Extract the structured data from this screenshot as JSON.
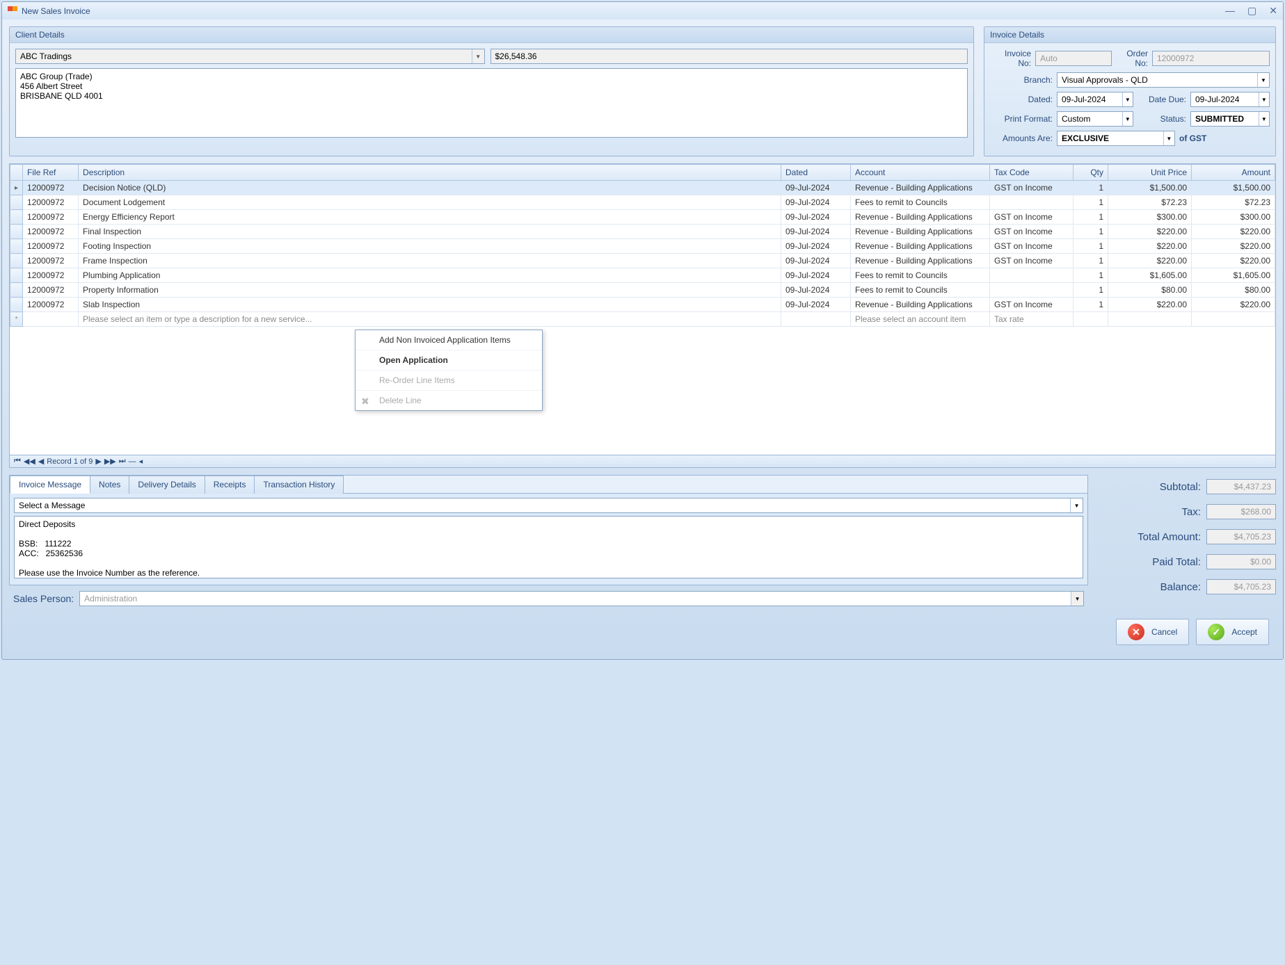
{
  "window": {
    "title": "New Sales Invoice"
  },
  "client": {
    "panel_title": "Client Details",
    "name": "ABC Tradings",
    "amount": "$26,548.36",
    "address": "ABC Group (Trade)\n456 Albert Street\nBRISBANE QLD 4001"
  },
  "invoice": {
    "panel_title": "Invoice Details",
    "labels": {
      "invoice_no": "Invoice No:",
      "order_no": "Order No:",
      "branch": "Branch:",
      "dated": "Dated:",
      "date_due": "Date Due:",
      "print_format": "Print Format:",
      "status": "Status:",
      "amounts_are": "Amounts Are:",
      "of_gst": "of GST"
    },
    "invoice_no": "Auto",
    "order_no": "12000972",
    "branch": "Visual Approvals - QLD",
    "dated": "09-Jul-2024",
    "date_due": "09-Jul-2024",
    "print_format": "Custom",
    "status": "SUBMITTED",
    "amounts_are": "EXCLUSIVE"
  },
  "grid": {
    "headers": {
      "file_ref": "File Ref",
      "description": "Description",
      "dated": "Dated",
      "account": "Account",
      "tax_code": "Tax Code",
      "qty": "Qty",
      "unit_price": "Unit Price",
      "amount": "Amount"
    },
    "rows": [
      {
        "file_ref": "12000972",
        "description": "Decision Notice (QLD)",
        "dated": "09-Jul-2024",
        "account": "Revenue - Building Applications",
        "tax_code": "GST on Income",
        "qty": "1",
        "unit_price": "$1,500.00",
        "amount": "$1,500.00"
      },
      {
        "file_ref": "12000972",
        "description": "Document Lodgement",
        "dated": "09-Jul-2024",
        "account": "Fees to remit to Councils",
        "tax_code": "",
        "qty": "1",
        "unit_price": "$72.23",
        "amount": "$72.23"
      },
      {
        "file_ref": "12000972",
        "description": "Energy Efficiency Report",
        "dated": "09-Jul-2024",
        "account": "Revenue - Building Applications",
        "tax_code": "GST on Income",
        "qty": "1",
        "unit_price": "$300.00",
        "amount": "$300.00"
      },
      {
        "file_ref": "12000972",
        "description": "Final Inspection",
        "dated": "09-Jul-2024",
        "account": "Revenue - Building Applications",
        "tax_code": "GST on Income",
        "qty": "1",
        "unit_price": "$220.00",
        "amount": "$220.00"
      },
      {
        "file_ref": "12000972",
        "description": "Footing Inspection",
        "dated": "09-Jul-2024",
        "account": "Revenue - Building Applications",
        "tax_code": "GST on Income",
        "qty": "1",
        "unit_price": "$220.00",
        "amount": "$220.00"
      },
      {
        "file_ref": "12000972",
        "description": "Frame Inspection",
        "dated": "09-Jul-2024",
        "account": "Revenue - Building Applications",
        "tax_code": "GST on Income",
        "qty": "1",
        "unit_price": "$220.00",
        "amount": "$220.00"
      },
      {
        "file_ref": "12000972",
        "description": "Plumbing Application",
        "dated": "09-Jul-2024",
        "account": "Fees to remit to Councils",
        "tax_code": "",
        "qty": "1",
        "unit_price": "$1,605.00",
        "amount": "$1,605.00"
      },
      {
        "file_ref": "12000972",
        "description": "Property Information",
        "dated": "09-Jul-2024",
        "account": "Fees to remit to Councils",
        "tax_code": "",
        "qty": "1",
        "unit_price": "$80.00",
        "amount": "$80.00"
      },
      {
        "file_ref": "12000972",
        "description": "Slab Inspection",
        "dated": "09-Jul-2024",
        "account": "Revenue - Building Applications",
        "tax_code": "GST on Income",
        "qty": "1",
        "unit_price": "$220.00",
        "amount": "$220.00"
      }
    ],
    "placeholder": {
      "description": "Please select an item or type a description for a new service...",
      "account": "Please select an account item",
      "tax_code": "Tax rate"
    },
    "nav": "Record 1 of 9"
  },
  "context_menu": {
    "add_items": "Add Non Invoiced Application Items",
    "open_app": "Open Application",
    "reorder": "Re-Order Line Items",
    "delete": "Delete Line"
  },
  "tabs": {
    "invoice_message": "Invoice Message",
    "notes": "Notes",
    "delivery": "Delivery Details",
    "receipts": "Receipts",
    "history": "Transaction History"
  },
  "message": {
    "select": "Select a Message",
    "body": "Direct Deposits\n\nBSB:   111222\nACC:   25362536\n\nPlease use the Invoice Number as the reference."
  },
  "sales_person": {
    "label": "Sales Person:",
    "value": "Administration"
  },
  "totals": {
    "subtotal_label": "Subtotal:",
    "subtotal": "$4,437.23",
    "tax_label": "Tax:",
    "tax": "$268.00",
    "total_label": "Total Amount:",
    "total": "$4,705.23",
    "paid_label": "Paid Total:",
    "paid": "$0.00",
    "balance_label": "Balance:",
    "balance": "$4,705.23"
  },
  "buttons": {
    "cancel": "Cancel",
    "accept": "Accept"
  }
}
